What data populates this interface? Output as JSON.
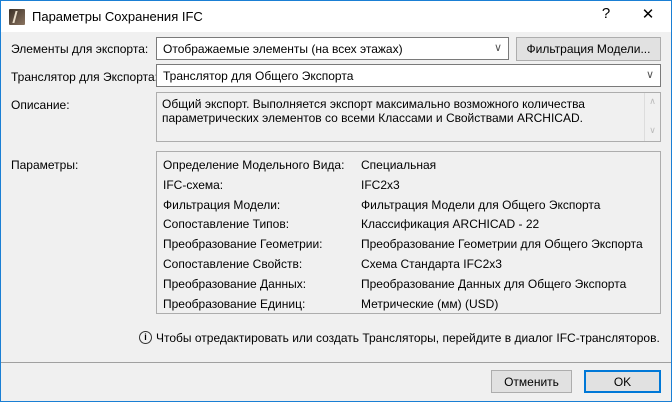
{
  "window": {
    "title": "Параметры Сохранения IFC",
    "help": "?",
    "close": "✕"
  },
  "elements": {
    "label": "Элементы для экспорта:",
    "value": "Отображаемые элементы (на всех этажах)",
    "filter_button": "Фильтрация Модели..."
  },
  "translator": {
    "label": "Транслятор для Экспорта:",
    "value": "Транслятор для Общего Экспорта"
  },
  "description": {
    "label": "Описание:",
    "text": "Общий экспорт. Выполняется экспорт максимально возможного количества параметрических элементов со всеми Классами и Свойствами ARCHICAD."
  },
  "parameters": {
    "label": "Параметры:",
    "rows": [
      {
        "name": "Определение Модельного Вида:",
        "value": "Специальная"
      },
      {
        "name": "IFC-схема:",
        "value": "IFC2x3"
      },
      {
        "name": "Фильтрация Модели:",
        "value": "Фильтрация Модели для Общего Экспорта"
      },
      {
        "name": "Сопоставление Типов:",
        "value": "Классификация ARCHICAD - 22"
      },
      {
        "name": "Преобразование Геометрии:",
        "value": "Преобразование Геометрии для Общего Экспорта"
      },
      {
        "name": "Сопоставление Свойств:",
        "value": "Схема Стандарта IFC2x3"
      },
      {
        "name": "Преобразование Данных:",
        "value": "Преобразование Данных для Общего Экспорта"
      },
      {
        "name": "Преобразование Единиц:",
        "value": "Метрические (мм) (USD)"
      }
    ]
  },
  "info": "Чтобы отредактировать или создать Трансляторы, перейдите в диалог IFC-трансляторов.",
  "buttons": {
    "cancel": "Отменить",
    "ok": "OK"
  },
  "colors": {
    "accent": "#0078d7"
  }
}
